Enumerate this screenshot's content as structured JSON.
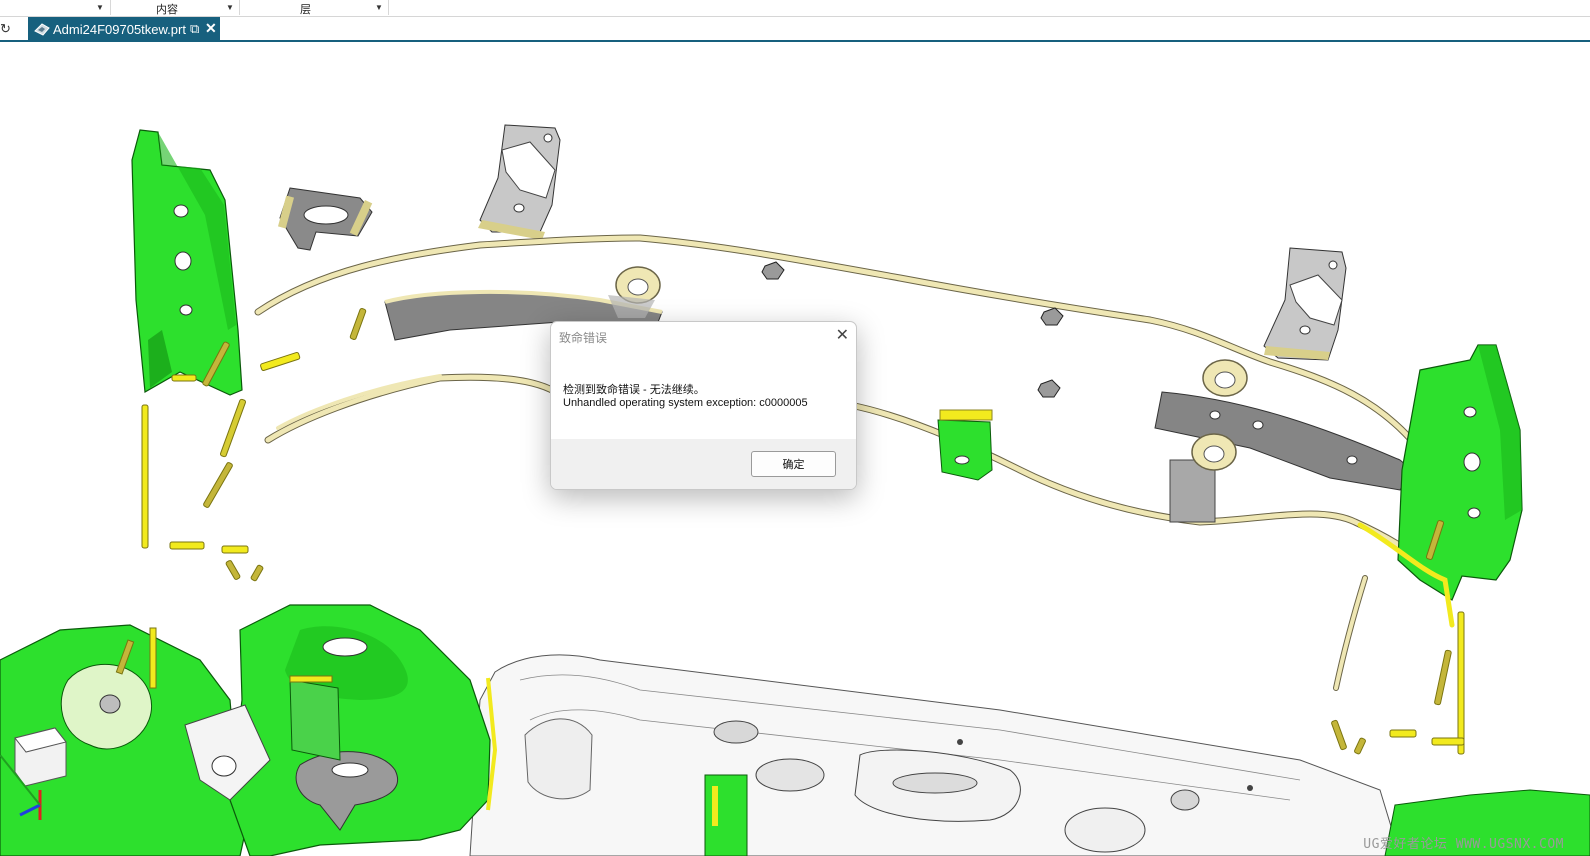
{
  "toolbar": {
    "field1_label": "",
    "field2_label": "内容",
    "field3_label": "层"
  },
  "tabs": [
    {
      "label": "Admi24F09705tkew.prt",
      "active": true
    }
  ],
  "dialog": {
    "title": "致命错误",
    "message_line1": "检测到致命错误 - 无法继续。",
    "message_line2": "Unhandled operating system exception: c0000005",
    "ok_label": "确定"
  },
  "watermark": "UG爱好者论坛 WWW.UGSNX.COM",
  "icons": {
    "refresh": "refresh-icon",
    "part": "part-file-icon",
    "popout": "popout-icon",
    "close": "close-icon",
    "axis": "wcs-triad-icon"
  },
  "colors": {
    "tab_active": "#17607e",
    "part_green": "#2de02d",
    "part_gray": "#8c8c8c",
    "wire_beige": "#efe7b4",
    "pin_yellow": "#f2ea1e"
  }
}
